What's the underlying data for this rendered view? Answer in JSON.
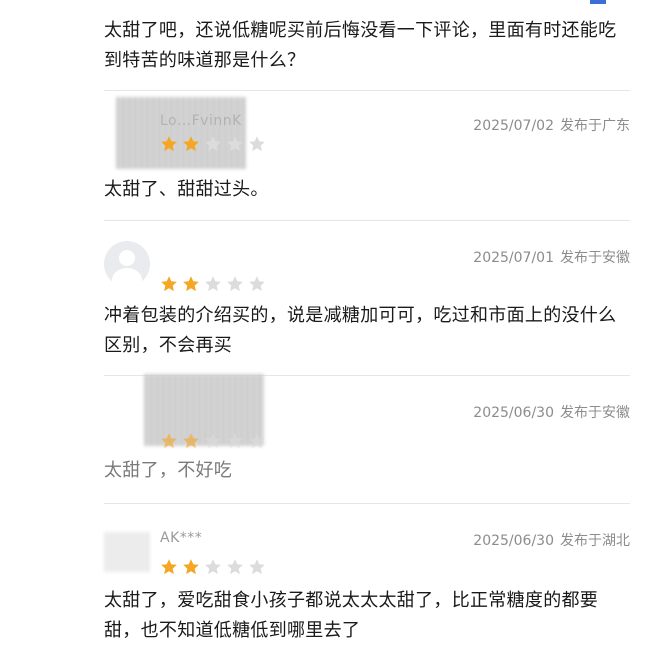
{
  "top_comment": {
    "text": "太甜了吧，还说低糖呢买前后悔没看一下评论，里面有时还能吃到特苦的味道那是什么？"
  },
  "reviews": [
    {
      "nickname": "Lo…FvinnK",
      "date": "2025/07/02",
      "location": "发布于广东",
      "rating": 2,
      "text": "太甜了、甜甜过头。"
    },
    {
      "nickname": "",
      "date": "2025/07/01",
      "location": "发布于安徽",
      "rating": 2,
      "text": "冲着包装的介绍买的，说是减糖加可可，吃过和市面上的没什么区别，不会再买"
    },
    {
      "nickname": "",
      "date": "2025/06/30",
      "location": "发布于安徽",
      "rating": 2,
      "text": "太甜了，不好吃"
    },
    {
      "nickname": "AK***",
      "date": "2025/06/30",
      "location": "发布于湖北",
      "rating": 2,
      "text": "太甜了，爱吃甜食小孩子都说太太太甜了，比正常糖度的都要甜，也不知道低糖低到哪里去了"
    }
  ],
  "colors": {
    "star_filled": "#f5a623",
    "star_empty": "#dcdcdc",
    "meta": "#8c8c8c",
    "divider": "#e6e6e6"
  },
  "icons": {
    "avatar": "default-user-avatar-icon",
    "star": "star-icon"
  }
}
